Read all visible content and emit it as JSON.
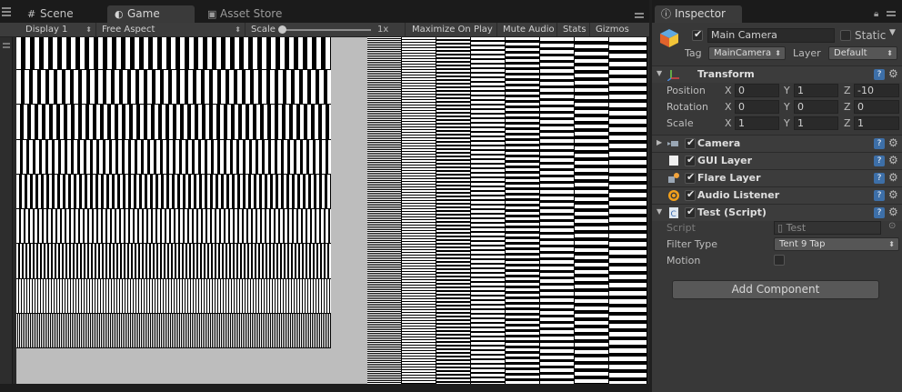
{
  "tabs": {
    "scene": "Scene",
    "game": "Game",
    "asset_store": "Asset Store"
  },
  "game_toolbar": {
    "display": "Display 1",
    "aspect": "Free Aspect",
    "scale_label": "Scale",
    "scale_value": "1x",
    "maximize": "Maximize On Play",
    "mute": "Mute Audio",
    "stats": "Stats",
    "gizmos": "Gizmos"
  },
  "inspector": {
    "tab": "Inspector",
    "object": {
      "name": "Main Camera",
      "active": true,
      "static_label": "Static",
      "static": false,
      "tag_label": "Tag",
      "tag": "MainCamera",
      "layer_label": "Layer",
      "layer": "Default"
    },
    "transform": {
      "title": "Transform",
      "position_label": "Position",
      "rotation_label": "Rotation",
      "scale_label": "Scale",
      "axes": [
        "X",
        "Y",
        "Z"
      ],
      "position": [
        "0",
        "1",
        "-10"
      ],
      "rotation": [
        "0",
        "0",
        "0"
      ],
      "scale": [
        "1",
        "1",
        "1"
      ]
    },
    "components": [
      {
        "title": "Camera",
        "enabled": true,
        "icon": "camera-icon"
      },
      {
        "title": "GUI Layer",
        "enabled": true,
        "icon": "gui-layer-icon"
      },
      {
        "title": "Flare Layer",
        "enabled": true,
        "icon": "flare-layer-icon"
      },
      {
        "title": "Audio Listener",
        "enabled": true,
        "icon": "audio-listener-icon"
      },
      {
        "title": "Test (Script)",
        "enabled": true,
        "icon": "script-icon"
      }
    ],
    "script_props": {
      "script_label": "Script",
      "script_value": "Test",
      "filter_label": "Filter Type",
      "filter_value": "Tent 9 Tap",
      "motion_label": "Motion",
      "motion": false
    },
    "add_component": "Add Component"
  },
  "colors": {
    "panel_bg": "#383838",
    "viewport_bg": "#000000",
    "pattern_fg": "#ffffff",
    "gray_fill": "#bdbdbd",
    "help_badge": "#3d6fa8"
  }
}
